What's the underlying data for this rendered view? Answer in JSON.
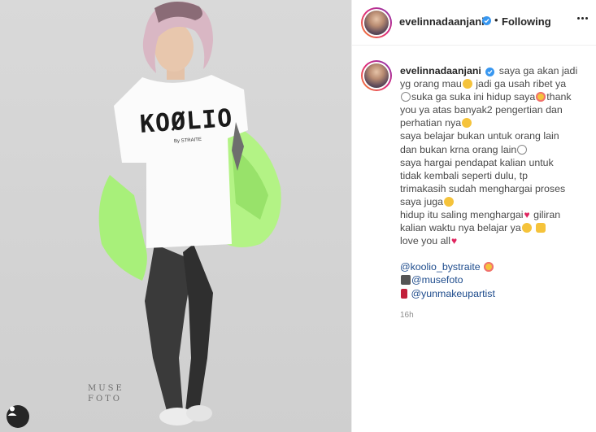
{
  "post": {
    "photo_watermark_line1": "MUSE",
    "photo_watermark_line2": "FOTO",
    "shirt_brand": "KOØLIO",
    "shirt_sub": "By STRAITE"
  },
  "header": {
    "username": "evelinnadaanjani",
    "separator": "•",
    "follow_status": "Following",
    "verified": true
  },
  "caption": {
    "username": "evelinnadaanjani",
    "lines": [
      "saya ga akan jadi",
      "yg orang mau",
      "jadi ga usah ribet ya",
      "suka ga suka ini hidup saya",
      "thank",
      "you ya atas banyak2 pengertian dan",
      "perhatian nya",
      "saya belajar bukan untuk orang lain",
      "dan bukan krna orang lain",
      "saya hargai pendapat kalian untuk",
      "tidak kembali seperti dulu, tp",
      "trimakasih sudah menghargai proses",
      "saya juga",
      "hidup itu saling menghargai",
      " giliran",
      "kalian waktu nya belajar ya",
      "love you all"
    ],
    "mentions": [
      "@koolio_bystraite",
      "@musefoto",
      "@yunmakeupartist"
    ],
    "timestamp": "16h"
  },
  "colors": {
    "verified_badge": "#3897f0",
    "mention": "#1d4b8c",
    "jacket": "#a8f07a",
    "heart": "#e0245e"
  },
  "icons": [
    "user-tag-icon",
    "more-options-icon",
    "verified-badge-icon",
    "camera-emoji-icon",
    "lipstick-emoji-icon"
  ]
}
